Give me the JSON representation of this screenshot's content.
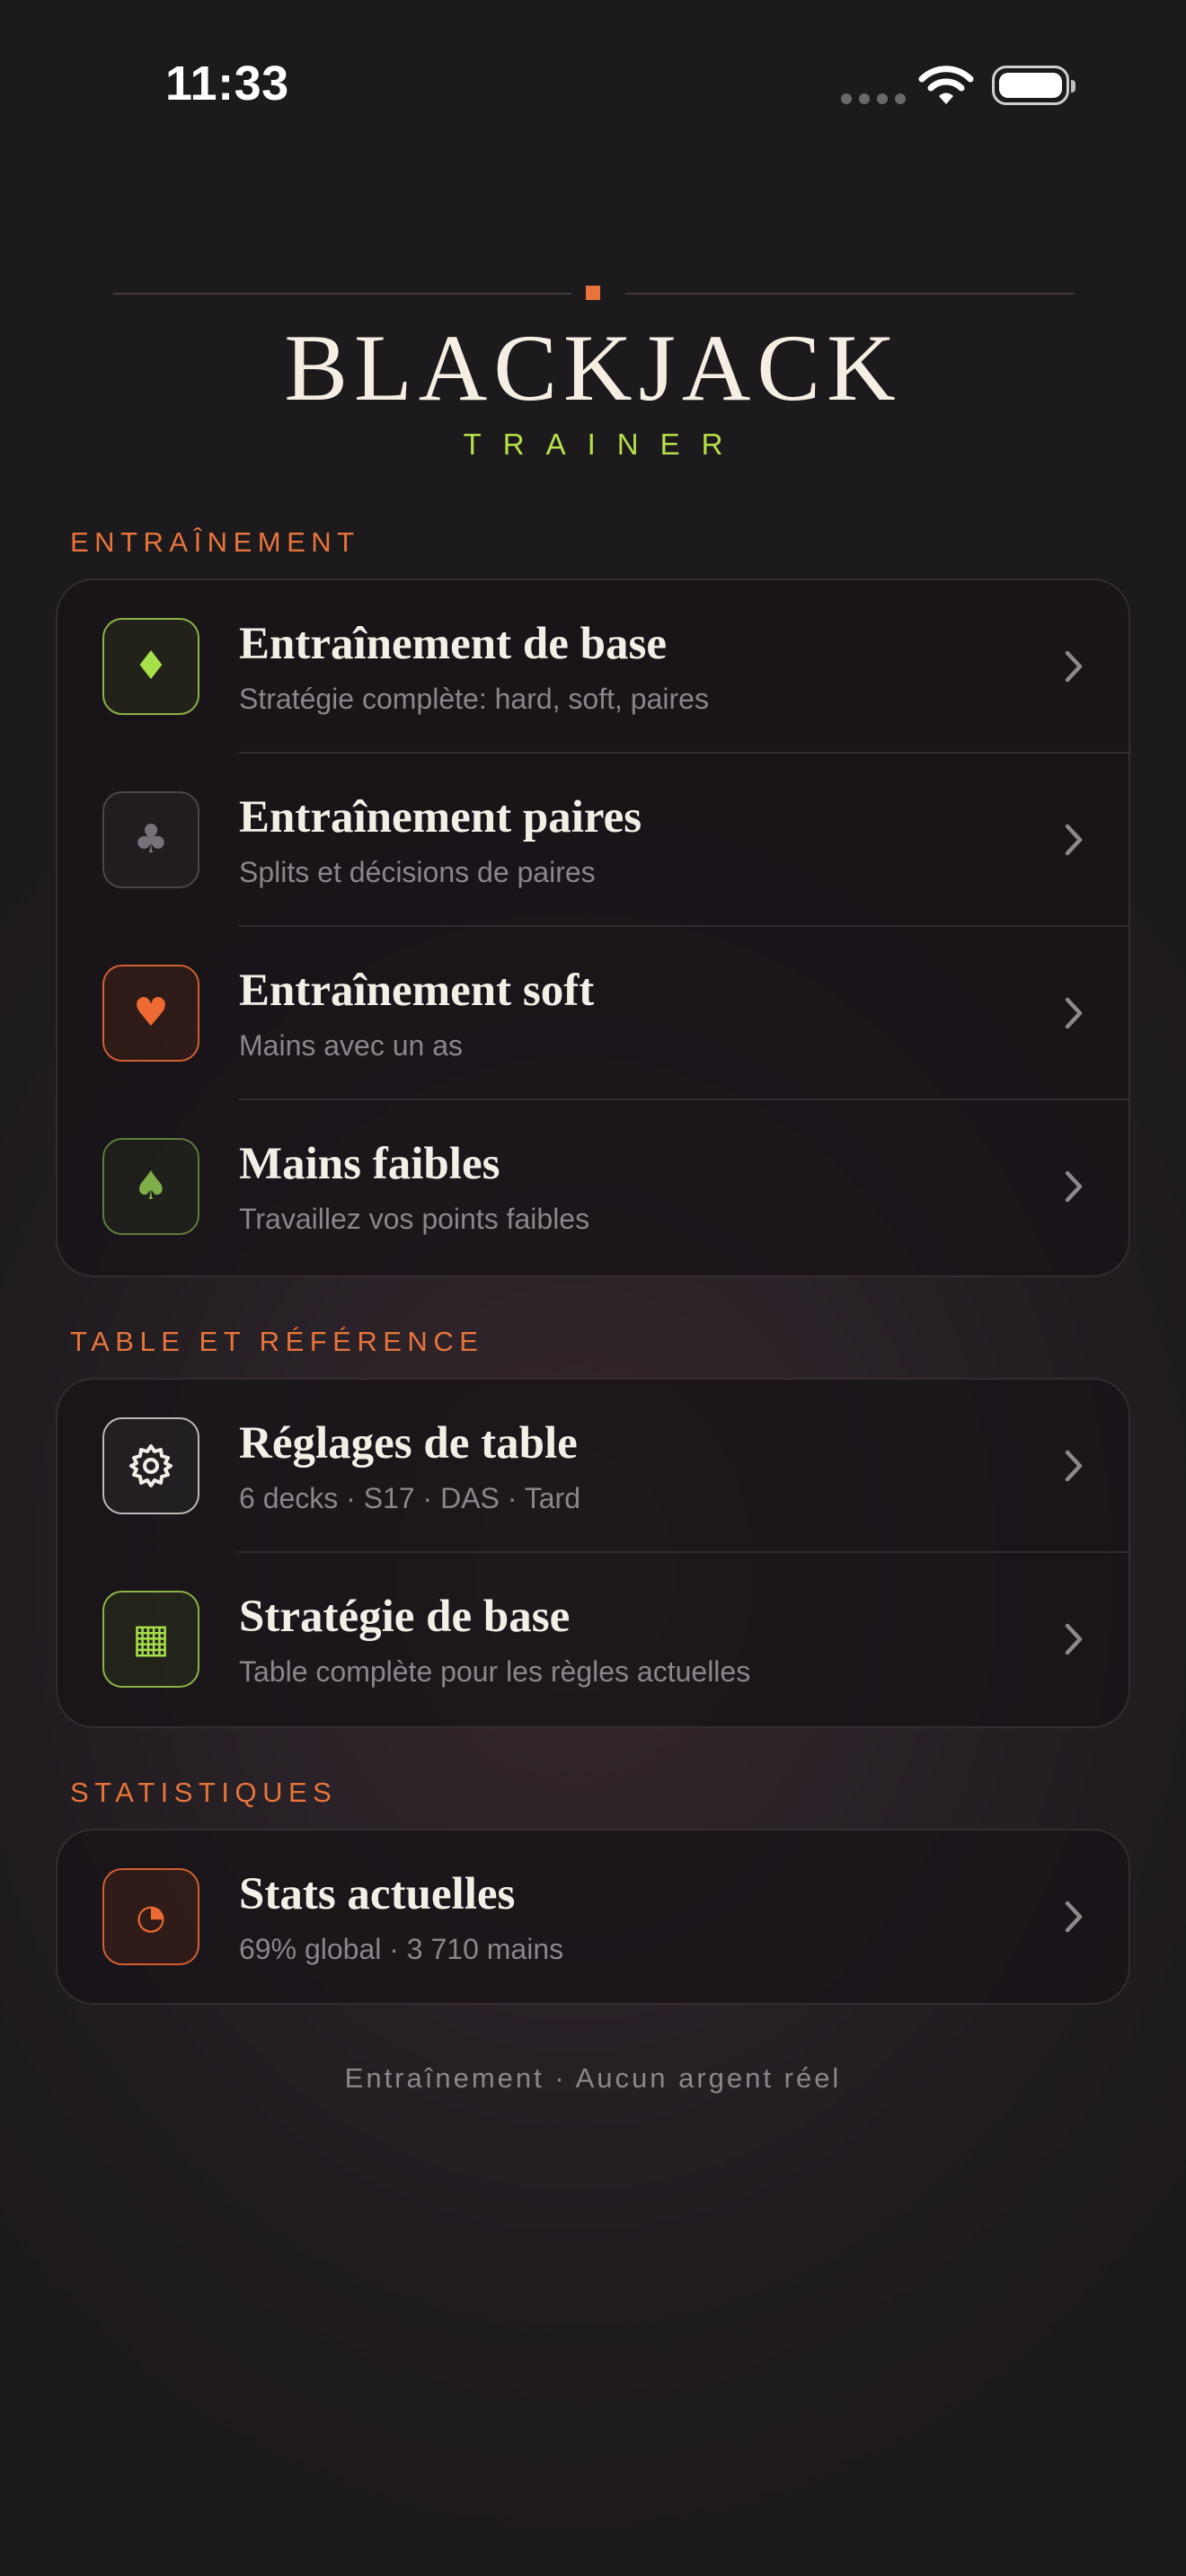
{
  "status_bar": {
    "time": "11:33"
  },
  "header": {
    "title": "BLACKJACK",
    "subtitle": "TRAINER"
  },
  "sections": [
    {
      "label": "ENTRAÎNEMENT",
      "items": [
        {
          "title": "Entraînement de base",
          "subtitle": "Stratégie complète: hard, soft, paires",
          "icon": "diamond-icon",
          "glyph": "♦"
        },
        {
          "title": "Entraînement paires",
          "subtitle": "Splits et décisions de paires",
          "icon": "club-icon",
          "glyph": "♣"
        },
        {
          "title": "Entraînement soft",
          "subtitle": "Mains avec un as",
          "icon": "heart-icon",
          "glyph": "♥"
        },
        {
          "title": "Mains faibles",
          "subtitle": "Travaillez vos points faibles",
          "icon": "spade-icon",
          "glyph": "♠"
        }
      ]
    },
    {
      "label": "TABLE ET RÉFÉRENCE",
      "items": [
        {
          "title": "Réglages de table",
          "subtitle": "6 decks · S17 · DAS · Tard",
          "icon": "gear-icon"
        },
        {
          "title": "Stratégie de base",
          "subtitle": "Table complète pour les règles actuelles",
          "icon": "grid-icon",
          "glyph": "▦"
        }
      ]
    },
    {
      "label": "STATISTIQUES",
      "items": [
        {
          "title": "Stats actuelles",
          "subtitle": "69% global · 3 710 mains",
          "icon": "pie-chart-icon",
          "glyph": "◔"
        }
      ]
    }
  ],
  "footer": {
    "note": "Entraînement · Aucun argent réel"
  },
  "colors": {
    "accent": "#e8743b",
    "brand_green": "#b5e04a",
    "background": "#211d21"
  }
}
